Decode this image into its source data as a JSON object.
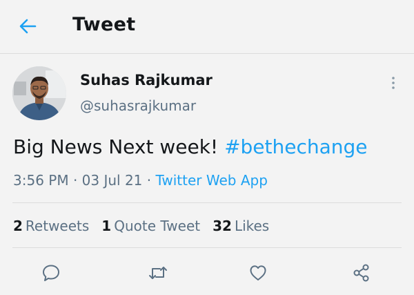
{
  "header": {
    "title": "Tweet",
    "back_icon": "arrow-left-icon",
    "accent_color": "#1da1f2"
  },
  "tweet": {
    "author": {
      "display_name": "Suhas Rajkumar",
      "handle": "@suhasrajkumar"
    },
    "text": "Big News Next week!",
    "hashtag": "#bethechange",
    "timestamp": "3:56 PM · 03 Jul 21 · ",
    "source": "Twitter Web App"
  },
  "stats": {
    "retweets_count": "2",
    "retweets_label": "Retweets",
    "quotes_count": "1",
    "quotes_label": "Quote Tweet",
    "likes_count": "32",
    "likes_label": "Likes"
  },
  "actions": [
    "reply-icon",
    "retweet-icon",
    "like-icon",
    "share-icon"
  ]
}
